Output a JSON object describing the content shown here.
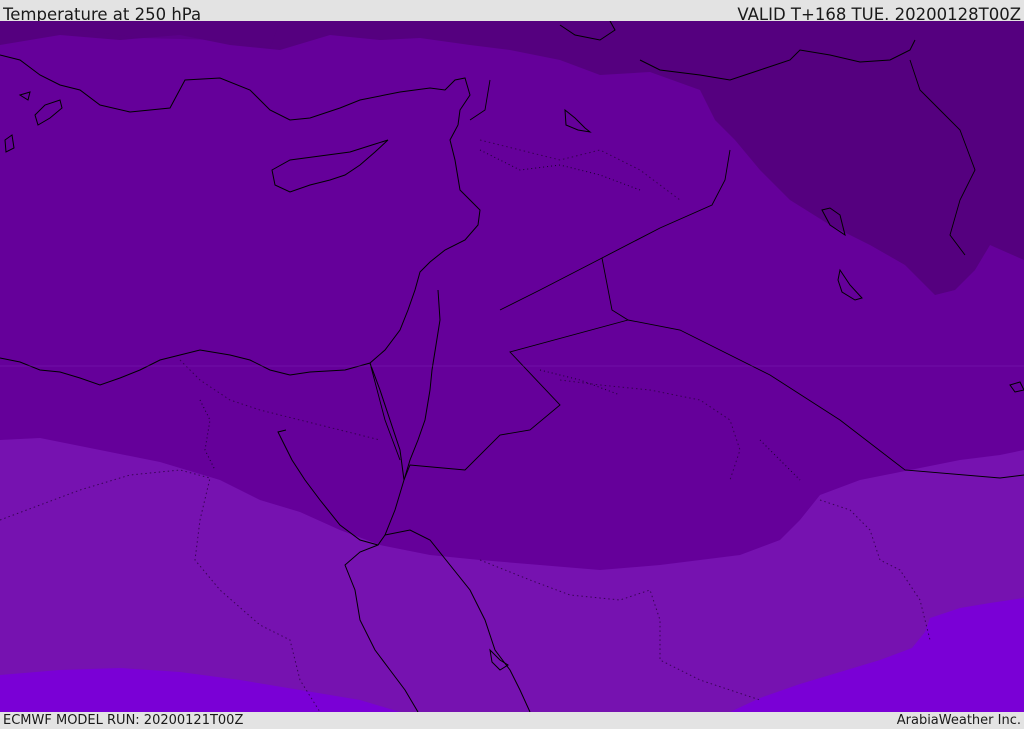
{
  "header": {
    "title": "Temperature at 250 hPa",
    "valid_time": "VALID T+168 TUE. 20200128T00Z"
  },
  "footer": {
    "model_run": "ECMWF MODEL RUN: 20200121T00Z",
    "credit": "ArabiaWeather Inc."
  },
  "map": {
    "variable": "Temperature",
    "level": "250 hPa",
    "colors": {
      "coldest_band": "#55007f",
      "cold_band": "#65009a",
      "mid_band": "#7612b0",
      "warm_band": "#7a00d6",
      "coastline": "#000000"
    }
  }
}
